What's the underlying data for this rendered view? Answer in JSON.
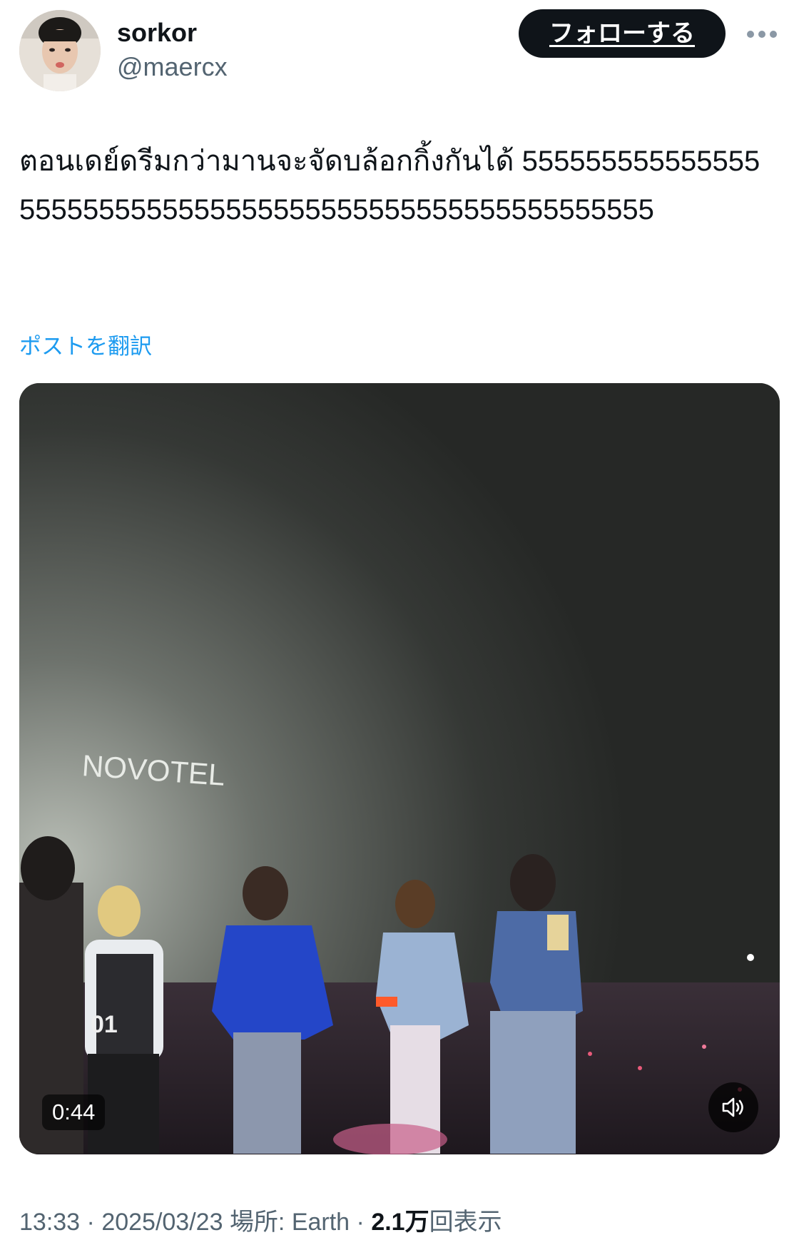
{
  "author": {
    "display_name": "sorkor",
    "handle": "@maercx",
    "follow_label": "フォローする"
  },
  "tweet": {
    "text": "ตอนเดย์ดรีมกว่ามานจะจัดบล้อกกิ้งกันได้ 5555555555555555555555555555555555555555555555555555555",
    "translate_label": "ポストを翻訳"
  },
  "media": {
    "duration": "0:44",
    "sign_text": "NOVOTEL",
    "jersey_number": "01",
    "mute_icon": "speaker-muted-icon"
  },
  "meta": {
    "time": "13:33",
    "separator1": " · ",
    "date": "2025/03/23",
    "location": "場所: Earth",
    "separator2": " · ",
    "views_count": "2.1万",
    "views_label": "回表示"
  },
  "icons": {
    "more": "more-horizontal-icon",
    "avatar": "avatar"
  },
  "colors": {
    "link_blue": "#1d9bf0",
    "text_primary": "#0f1419",
    "text_secondary": "#536471",
    "follow_bg": "#0f1419"
  }
}
